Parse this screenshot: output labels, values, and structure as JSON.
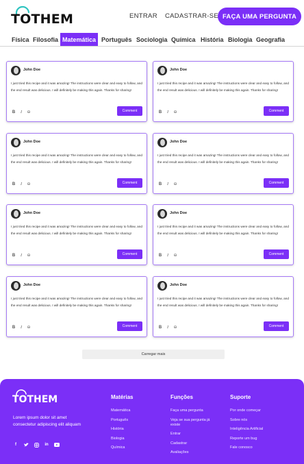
{
  "header": {
    "logo": "TOTHEM",
    "nav": {
      "entrar": "ENTRAR",
      "cadastrar": "CADASTRAR-SE"
    },
    "cta": "FAÇA UMA PERGUNTA"
  },
  "tabs": [
    {
      "label": "Física"
    },
    {
      "label": "Filosofia"
    },
    {
      "label": "Matemática"
    },
    {
      "label": "Português"
    },
    {
      "label": "Sociologia"
    },
    {
      "label": "Química"
    },
    {
      "label": "História"
    },
    {
      "label": "Biologia"
    },
    {
      "label": "Geografia"
    }
  ],
  "active_tab": "Matemática",
  "comments": [
    {
      "author": "John Doe",
      "text": "I just tried this recipe and it was amazing! The instructions were clear and easy to follow, and the end result was delicious. I will definitely be making this again. Thanks for sharing!",
      "button": "Comment"
    },
    {
      "author": "John Doe",
      "text": "I just tried this recipe and it was amazing! The instructions were clear and easy to follow, and the end result was delicious. I will definitely be making this again. Thanks for sharing!",
      "button": "Comment"
    },
    {
      "author": "John Doe",
      "text": "I just tried this recipe and it was amazing! The instructions were clear and easy to follow, and the end result was delicious. I will definitely be making this again. Thanks for sharing!",
      "button": "Comment"
    },
    {
      "author": "John Doe",
      "text": "I just tried this recipe and it was amazing! The instructions were clear and easy to follow, and the end result was delicious. I will definitely be making this again. Thanks for sharing!",
      "button": "Comment"
    },
    {
      "author": "John Doe",
      "text": "I just tried this recipe and it was amazing! The instructions were clear and easy to follow, and the end result was delicious. I will definitely be making this again. Thanks for sharing!",
      "button": "Comment"
    },
    {
      "author": "John Doe",
      "text": "I just tried this recipe and it was amazing! The instructions were clear and easy to follow, and the end result was delicious. I will definitely be making this again. Thanks for sharing!",
      "button": "Comment"
    },
    {
      "author": "John Doe",
      "text": "I just tried this recipe and it was amazing! The instructions were clear and easy to follow, and the end result was delicious. I will definitely be making this again. Thanks for sharing!",
      "button": "Comment"
    },
    {
      "author": "John Doe",
      "text": "I just tried this recipe and it was amazing! The instructions were clear and easy to follow, and the end result was delicious. I will definitely be making this again. Thanks for sharing!",
      "button": "Comment"
    }
  ],
  "editor_tools": [
    "bold-icon",
    "italic-icon",
    "link-icon"
  ],
  "load_more": "Carregar mais",
  "footer": {
    "logo": "TOTHEM",
    "description": "Lorem ipsum dolor sit amet consectetur adipiscing elit aliquam",
    "socials": [
      "facebook-icon",
      "twitter-icon",
      "instagram-icon",
      "linkedin-icon",
      "youtube-icon"
    ],
    "columns": [
      {
        "title": "Matérias",
        "items": [
          "Matemática",
          "Português",
          "História",
          "Biologia",
          "Química"
        ]
      },
      {
        "title": "Funções",
        "items": [
          "Faça uma pergunta",
          "Veja se sua pergunta já existe",
          "Entrar",
          "Cadastrar",
          "Avaliações"
        ]
      },
      {
        "title": "Suporte",
        "items": [
          "Por onde começar",
          "Sobre nós",
          "Inteligência Artificial",
          "Reporte um bug",
          "Fale conosco"
        ]
      }
    ]
  },
  "colors": {
    "accent": "#7b2ff7",
    "logo_arc": "#2ec4c0"
  }
}
